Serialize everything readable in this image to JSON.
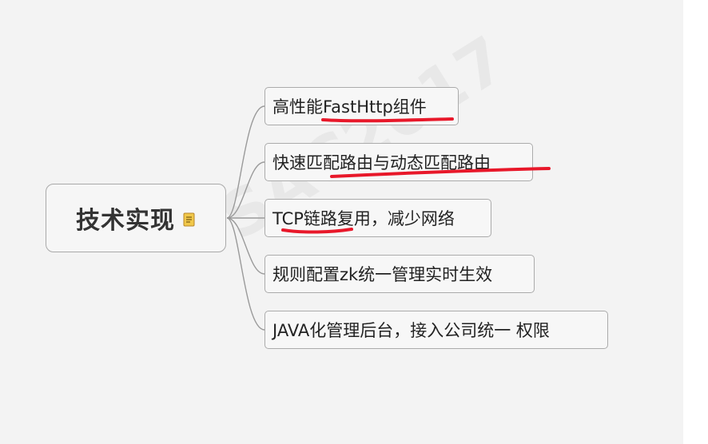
{
  "mindmap": {
    "root": {
      "label": "技术实现",
      "icon": "note-icon"
    },
    "branches": [
      {
        "label": "高性能FastHttp组件",
        "underlined": true
      },
      {
        "label": "快速匹配路由与动态匹配路由",
        "underlined": true
      },
      {
        "label": "TCP链路复用，减少网络",
        "underlined": true
      },
      {
        "label": "规则配置zk统一管理实时生效",
        "underlined": false
      },
      {
        "label": "JAVA化管理后台，接入公司统一 权限",
        "underlined": false
      }
    ]
  },
  "colors": {
    "canvas": "#f3f3f3",
    "node_border": "#ababab",
    "connector": "#9a9a9a",
    "annotation": "#e8182a",
    "note_icon": "#e8b93a"
  }
}
